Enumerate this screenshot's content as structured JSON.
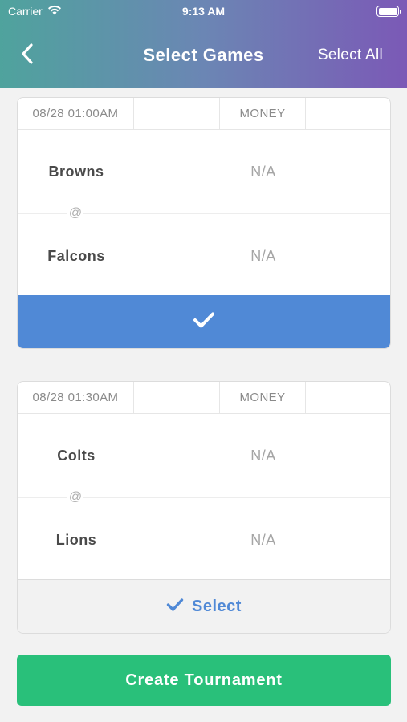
{
  "status_bar": {
    "carrier": "Carrier",
    "time": "9:13 AM"
  },
  "nav": {
    "title": "Select Games",
    "select_all": "Select All"
  },
  "games": [
    {
      "datetime": "08/28 01:00AM",
      "market": "MONEY",
      "away_team": "Browns",
      "home_team": "Falcons",
      "away_odds": "N/A",
      "home_odds": "N/A",
      "separator": "@",
      "selected": true
    },
    {
      "datetime": "08/28 01:30AM",
      "market": "MONEY",
      "away_team": "Colts",
      "home_team": "Lions",
      "away_odds": "N/A",
      "home_odds": "N/A",
      "separator": "@",
      "selected": false,
      "select_label": "Select"
    }
  ],
  "create_button": "Create Tournament",
  "colors": {
    "header_gradient_start": "#4fa39d",
    "header_gradient_end": "#7b59b6",
    "selected_blue": "#5089d6",
    "create_green": "#29c07a"
  }
}
